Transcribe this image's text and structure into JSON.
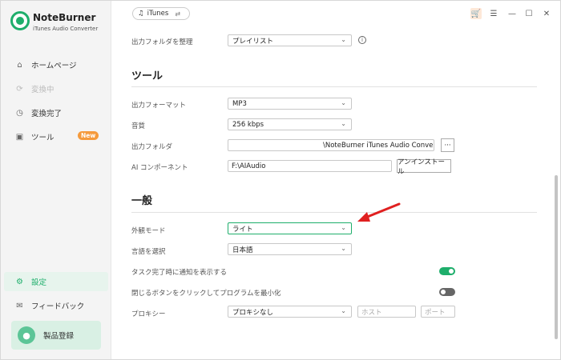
{
  "brand": {
    "name": "NoteBurner",
    "subtitle": "iTunes Audio Converter"
  },
  "sidebar": {
    "items": [
      {
        "label": "ホームページ",
        "icon": "home-icon"
      },
      {
        "label": "変換中",
        "icon": "converting-icon",
        "disabled": true
      },
      {
        "label": "変換完了",
        "icon": "clock-icon"
      },
      {
        "label": "ツール",
        "icon": "toolbox-icon",
        "badge": "New"
      },
      {
        "label": "設定",
        "icon": "settings-icon",
        "active": true
      },
      {
        "label": "フィードバック",
        "icon": "mail-icon"
      }
    ],
    "register_label": "製品登録"
  },
  "header": {
    "source_label": "iTunes",
    "window_buttons": [
      "cart-icon",
      "menu-icon",
      "minimize-icon",
      "maximize-icon",
      "close-icon"
    ]
  },
  "settings": {
    "organize_output": {
      "label": "出力フォルダを整理",
      "value": "プレイリスト"
    },
    "tools_title": "ツール",
    "output_format": {
      "label": "出力フォーマット",
      "value": "MP3"
    },
    "quality": {
      "label": "音質",
      "value": "256 kbps"
    },
    "output_folder": {
      "label": "出力フォルダ",
      "value": "\\NoteBurner iTunes Audio Convert",
      "browse_label": "···"
    },
    "ai_component": {
      "label": "AI コンポーネント",
      "value": "F:\\AIAudio",
      "uninstall_label": "アンインストール"
    },
    "general_title": "一般",
    "appearance": {
      "label": "外観モード",
      "value": "ライト"
    },
    "language": {
      "label": "言語を選択",
      "value": "日本語"
    },
    "notify_on_complete": {
      "label": "タスク完了時に通知を表示する",
      "enabled": true
    },
    "minimize_on_close": {
      "label": "閉じるボタンをクリックしてプログラムを最小化",
      "enabled": false
    },
    "proxy": {
      "label": "プロキシー",
      "value": "プロキシなし",
      "host_placeholder": "ホスト",
      "port_placeholder": "ポート"
    }
  },
  "colors": {
    "accent": "#1eae6b",
    "badge": "#f59a3c",
    "arrow": "#e02020"
  }
}
